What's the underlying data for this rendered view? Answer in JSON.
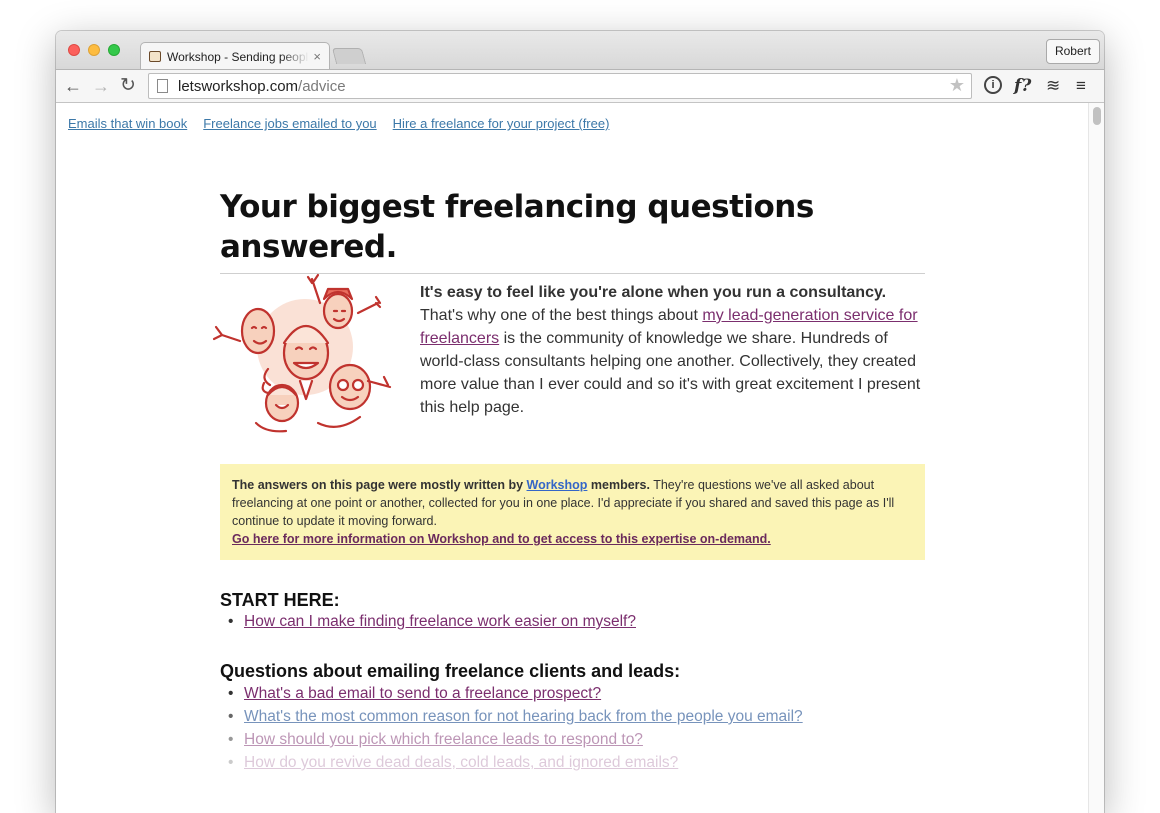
{
  "browser": {
    "tab_title": "Workshop - Sending people",
    "tab_close": "×",
    "profile_name": "Robert",
    "url_host": "letsworkshop.com",
    "url_path": "/advice",
    "star": "★",
    "ext_info": "i",
    "ext_f": "f?",
    "ext_layers": "≋",
    "ext_menu": "≡",
    "back": "←",
    "forward": "→",
    "reload": "↻"
  },
  "topnav": {
    "items": [
      "Emails that win book",
      "Freelance jobs emailed to you",
      "Hire a freelance for your project (free)"
    ]
  },
  "page": {
    "headline": "Your biggest freelancing questions answered.",
    "intro_bold": "It's easy to feel like you're alone when you run a consultancy.",
    "intro_part1": "That's why one of the best things about",
    "intro_link": "my lead-generation service for freelancers",
    "intro_part2": "is the community of knowledge we share. Hundreds of world-class consultants helping one another. Collectively, they created more value than I ever could and so it's with great excitement I present this help page.",
    "notice_bold1": "The answers on this page were mostly written by",
    "notice_link": "Workshop",
    "notice_bold2": "members.",
    "notice_text": "They're questions we've all asked about freelancing at one point or another, collected for you in one place. I'd appreciate if you shared and saved this page as I'll continue to update it moving forward.",
    "notice_cta": "Go here for more information on Workshop and to get access to this expertise on-demand."
  },
  "sections": [
    {
      "heading": "START HERE:",
      "questions": [
        "How can I make finding freelance work easier on myself?"
      ]
    },
    {
      "heading": "Questions about emailing freelance clients and leads:",
      "questions": [
        "What's a bad email to send to a freelance prospect?",
        "What's the most common reason for not hearing back from the people you email?",
        "How should you pick which freelance leads to respond to?",
        "How do you revive dead deals, cold leads, and ignored emails?"
      ]
    }
  ],
  "colors": {
    "link_visited": "#7b2e6e",
    "link_blue": "#3c78a8",
    "notice_bg": "#fbf4b6",
    "illustration_red": "#c0332e"
  }
}
